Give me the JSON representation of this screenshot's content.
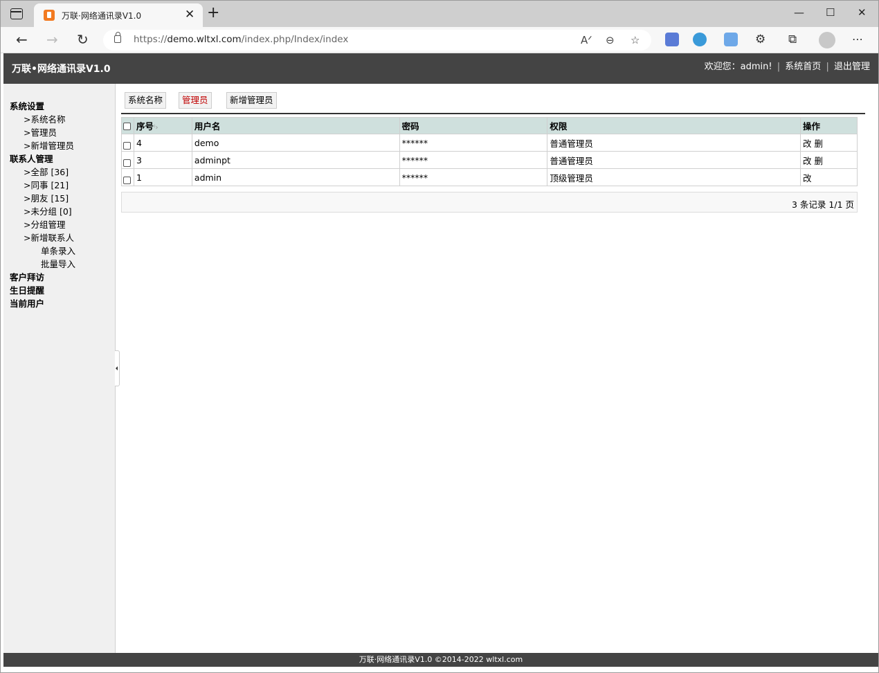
{
  "browser": {
    "tab_title": "万联·网络通讯录V1.0",
    "url_prefix": "https://",
    "url_host": "demo.wltxl.com",
    "url_path": "/index.php/Index/index"
  },
  "header": {
    "title": "万联•网络通讯录V1.0",
    "welcome": "欢迎您：admin!",
    "home_link": "系统首页",
    "logout_link": "退出管理"
  },
  "sidebar": {
    "items": [
      {
        "label": "系统设置",
        "level": "group"
      },
      {
        "label": ">系统名称",
        "level": "l1"
      },
      {
        "label": ">管理员",
        "level": "l1"
      },
      {
        "label": ">新增管理员",
        "level": "l1"
      },
      {
        "label": "联系人管理",
        "level": "group"
      },
      {
        "label": ">全部 [36]",
        "level": "l1"
      },
      {
        "label": ">同事 [21]",
        "level": "l1"
      },
      {
        "label": ">朋友 [15]",
        "level": "l1"
      },
      {
        "label": ">未分组 [0]",
        "level": "l1"
      },
      {
        "label": ">分组管理",
        "level": "l1"
      },
      {
        "label": ">新增联系人",
        "level": "l1"
      },
      {
        "label": "单条录入",
        "level": "l2"
      },
      {
        "label": "批量导入",
        "level": "l2"
      },
      {
        "label": "客户拜访",
        "level": "group"
      },
      {
        "label": "生日提醒",
        "level": "group"
      },
      {
        "label": "当前用户",
        "level": "group"
      }
    ]
  },
  "subtabs": [
    {
      "label": "系统名称",
      "active": false
    },
    {
      "label": "管理员",
      "active": true
    },
    {
      "label": "新增管理员",
      "active": false
    }
  ],
  "table": {
    "columns": [
      "序号",
      "用户名",
      "密码",
      "权限",
      "操作"
    ],
    "rows": [
      {
        "id": "4",
        "username": "demo",
        "password": "******",
        "role": "普通管理员",
        "edit": "改",
        "delete": "删"
      },
      {
        "id": "3",
        "username": "adminpt",
        "password": "******",
        "role": "普通管理员",
        "edit": "改",
        "delete": "删"
      },
      {
        "id": "1",
        "username": "admin",
        "password": "******",
        "role": "顶级管理员",
        "edit": "改",
        "delete": ""
      }
    ]
  },
  "pager": {
    "text": "3 条记录 1/1 页"
  },
  "footer": {
    "text": "万联·网络通讯录V1.0 ©2014-2022 wltxl.com"
  },
  "colors": {
    "header_bg": "#444444",
    "sidebar_bg": "#f0f0f0",
    "table_header_bg": "#cfe0dd",
    "active_tab": "#c00000"
  }
}
